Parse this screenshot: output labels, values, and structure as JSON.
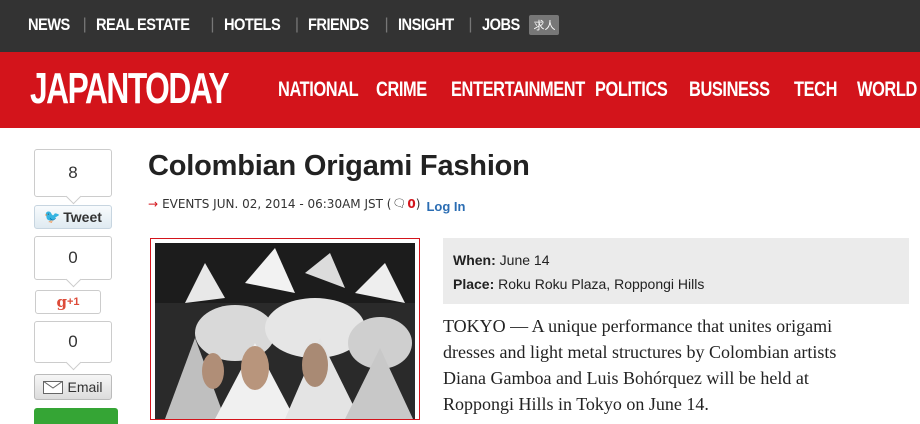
{
  "topnav": {
    "items": [
      "NEWS",
      "REAL ESTATE",
      "HOTELS",
      "FRIENDS",
      "INSIGHT",
      "JOBS"
    ],
    "jobs_badge": "求人"
  },
  "brand": {
    "logo": "JAPANTODAY",
    "color": "#d3141b"
  },
  "mainnav": {
    "items": [
      "NATIONAL",
      "CRIME",
      "ENTERTAINMENT",
      "POLITICS",
      "BUSINESS",
      "TECH",
      "WORLD C"
    ]
  },
  "share": {
    "tweet_count": "8",
    "tweet_label": "Tweet",
    "gplus_count": "0",
    "gplus_label": "+1",
    "email_count": "0",
    "email_label": "Email"
  },
  "article": {
    "title": "Colombian Origami Fashion",
    "meta": "EVENTS JUN. 02, 2014 - 06:30AM JST (",
    "comment_count": "0",
    "meta_close": ")",
    "login": "Log In",
    "when_label": "When:",
    "when_value": "June 14",
    "place_label": "Place:",
    "place_value": "Roku Roku Plaza, Roppongi Hills",
    "body": "TOKYO — A unique performance that unites origami dresses and light metal structures by Colombian artists Diana Gamboa and Luis Bohórquez will be held at Roppongi Hills in Tokyo on June 14."
  }
}
